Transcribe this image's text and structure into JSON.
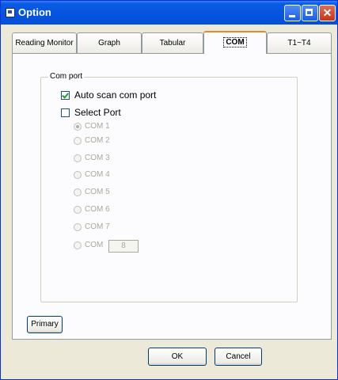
{
  "window": {
    "title": "Option"
  },
  "tabs": [
    {
      "label": "Reading Monitor",
      "active": false
    },
    {
      "label": "Graph",
      "active": false
    },
    {
      "label": "Tabular",
      "active": false
    },
    {
      "label": "COM",
      "active": true
    },
    {
      "label": "T1~T4",
      "active": false
    }
  ],
  "com_port_group": {
    "label": "Com port",
    "auto_scan": {
      "label": "Auto scan  com port",
      "checked": true
    },
    "select_port": {
      "label": "Select Port",
      "checked": false
    },
    "ports": [
      {
        "label": "COM 1",
        "selected": true
      },
      {
        "label": "COM 2",
        "selected": false
      },
      {
        "label": "COM 3",
        "selected": false
      },
      {
        "label": "COM 4",
        "selected": false
      },
      {
        "label": "COM 5",
        "selected": false
      },
      {
        "label": "COM 6",
        "selected": false
      },
      {
        "label": "COM 7",
        "selected": false
      },
      {
        "label": "COM",
        "selected": false
      }
    ],
    "custom_port_value": "8"
  },
  "buttons": {
    "primary": "Primary",
    "ok": "OK",
    "cancel": "Cancel"
  },
  "colors": {
    "titlebar": "#0553E0",
    "active_tab_accent": "#E68B2C",
    "disabled_text": "#ACA899"
  }
}
